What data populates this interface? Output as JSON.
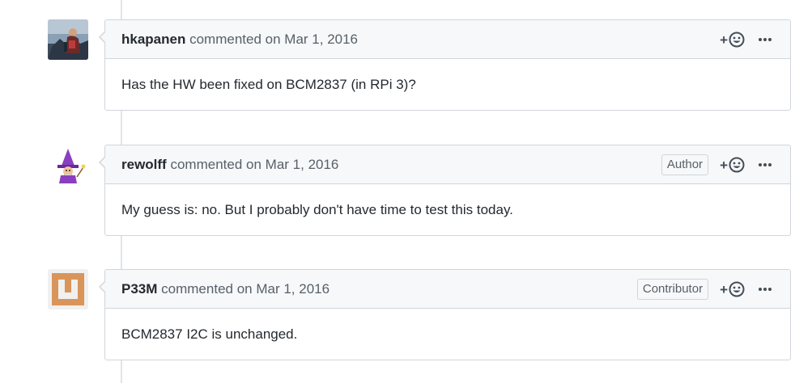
{
  "comments": [
    {
      "author": "hkapanen",
      "action": "commented",
      "date": "on Mar 1, 2016",
      "badge": "",
      "body": "Has the HW been fixed on BCM2837 (in RPi 3)?",
      "avatar_icon": "user-photo-avatar"
    },
    {
      "author": "rewolff",
      "action": "commented",
      "date": "on Mar 1, 2016",
      "badge": "Author",
      "body": "My guess is: no. But I probably don't have time to test this today.",
      "avatar_icon": "wizard-avatar"
    },
    {
      "author": "P33M",
      "action": "commented",
      "date": "on Mar 1, 2016",
      "badge": "Contributor",
      "body": "BCM2837 I2C is unchanged.",
      "avatar_icon": "identicon-avatar"
    }
  ],
  "actions": {
    "add_reaction_plus": "+",
    "reaction_icon": "smiley-icon",
    "more_icon": "kebab-horizontal-icon"
  },
  "colors": {
    "header_bg": "#f6f8fa",
    "border": "#d1d5da",
    "identicon": "#d9945a"
  }
}
